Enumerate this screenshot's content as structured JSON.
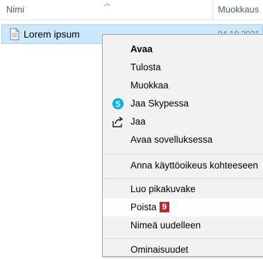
{
  "header": {
    "name_column": "Nimi",
    "modified_column": "Muokkaus"
  },
  "file": {
    "name": "Lorem ipsum",
    "modified": "04.10.2021"
  },
  "context_menu": {
    "items": [
      {
        "label": "Avaa",
        "bold": true
      },
      {
        "label": "Tulosta"
      },
      {
        "label": "Muokkaa"
      },
      {
        "label": "Jaa Skypessa",
        "icon": "skype-icon"
      },
      {
        "label": "Jaa",
        "icon": "share-icon"
      },
      {
        "label": "Avaa sovelluksessa"
      },
      {
        "label": "Anna käyttöoikeus kohteeseen"
      },
      {
        "label": "Luo pikakuvake"
      },
      {
        "label": "Poista",
        "badge": "9",
        "hovered": true
      },
      {
        "label": "Nimeä uudelleen"
      },
      {
        "label": "Ominaisuudet"
      }
    ]
  },
  "colors": {
    "selection_bg": "#cce8ff",
    "selection_border": "#99d1ff",
    "menu_bg": "#f2f2f2",
    "badge_bg": "#c0262d",
    "skype_blue": "#00aff0"
  }
}
